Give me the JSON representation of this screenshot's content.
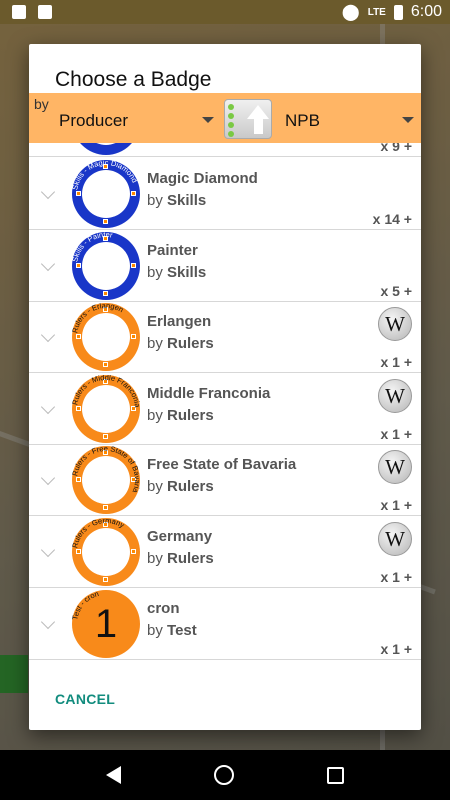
{
  "status_bar": {
    "time": "6:00",
    "network": "LTE"
  },
  "dialog": {
    "title": "Choose a Badge",
    "filter": {
      "by_label": "by",
      "group_by": "Producer",
      "sort_value": "NPB"
    },
    "cancel_label": "CANCEL"
  },
  "partial_row": {
    "count": "x 9 +",
    "badge_text": "range"
  },
  "rows": [
    {
      "name": "Magic Diamond",
      "by_prefix": "by",
      "producer": "Skills",
      "count": "x 14 +",
      "badge_color": "blue",
      "badge_text": "Skills - Magic Diamond",
      "icon": "diamond-icon",
      "has_wiki": false
    },
    {
      "name": "Painter",
      "by_prefix": "by",
      "producer": "Skills",
      "count": "x 5 +",
      "badge_color": "blue",
      "badge_text": "Skills - Painter",
      "icon": "paintbrush-icon",
      "has_wiki": false
    },
    {
      "name": "Erlangen",
      "by_prefix": "by",
      "producer": "Rulers",
      "count": "x 1 +",
      "badge_color": "orange",
      "badge_text": "Rulers - Erlangen",
      "icon": "coat-of-arms-icon",
      "has_wiki": true
    },
    {
      "name": "Middle Franconia",
      "by_prefix": "by",
      "producer": "Rulers",
      "count": "x 1 +",
      "badge_color": "orange",
      "badge_text": "Rulers - Middle Franconia",
      "icon": "coat-of-arms-icon",
      "has_wiki": true
    },
    {
      "name": "Free State of Bavaria",
      "by_prefix": "by",
      "producer": "Rulers",
      "count": "x 1 +",
      "badge_color": "orange",
      "badge_text": "Rulers - Free State of Bavaria",
      "icon": "coat-of-arms-icon",
      "has_wiki": true
    },
    {
      "name": "Germany",
      "by_prefix": "by",
      "producer": "Rulers",
      "count": "x 1 +",
      "badge_color": "orange",
      "badge_text": "Rulers - Germany",
      "icon": "eagle-icon",
      "has_wiki": true
    },
    {
      "name": "cron",
      "by_prefix": "by",
      "producer": "Test",
      "count": "x 1 +",
      "badge_color": "orange",
      "badge_text": "Test - cron",
      "badge_number": "1",
      "icon": "number-badge-icon",
      "has_wiki": false
    }
  ],
  "wiki_symbol": "W",
  "colors": {
    "filter_bar": "#ffb565",
    "accent": "#128c7e",
    "badge_blue": "#1936c8",
    "badge_orange": "#f88a1a"
  }
}
